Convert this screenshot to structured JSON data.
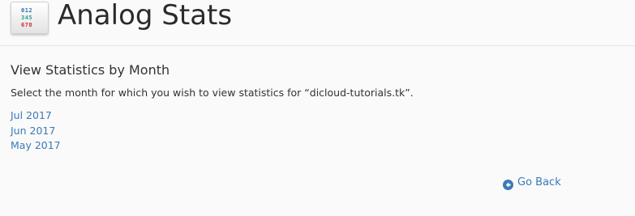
{
  "header": {
    "title": "Analog Stats",
    "icon_digits": [
      "012",
      "345",
      "678"
    ]
  },
  "section": {
    "heading": "View Statistics by Month",
    "description": "Select the month for which you wish to view statistics for “dicloud-tutorials.tk”."
  },
  "months": [
    {
      "label": "Jul 2017"
    },
    {
      "label": "Jun 2017"
    },
    {
      "label": "May 2017"
    }
  ],
  "footer": {
    "go_back_label": "Go Back",
    "go_back_icon": "arrow-circle-left-icon"
  },
  "colors": {
    "background": "#fafafa",
    "link": "#3a7ab8",
    "text": "#333333"
  }
}
